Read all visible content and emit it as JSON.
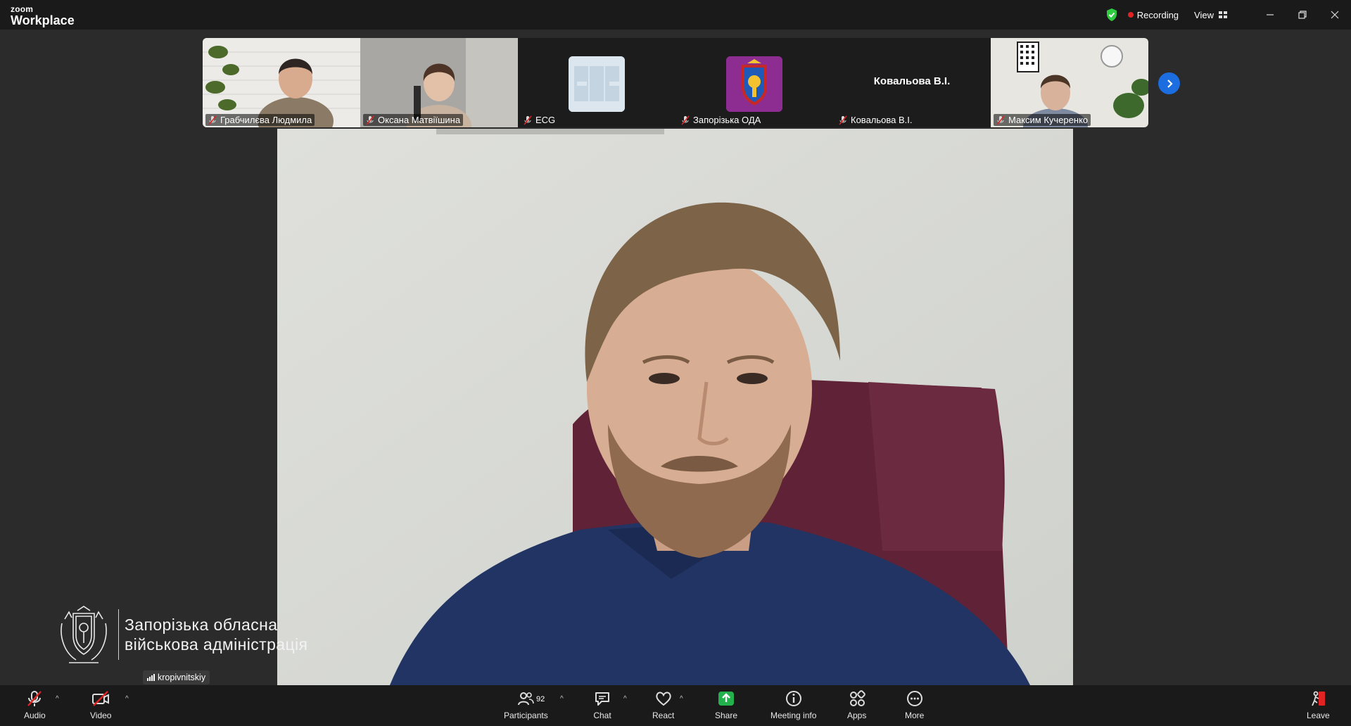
{
  "app": {
    "logo_small": "zoom",
    "logo_large": "Workplace"
  },
  "titlebar": {
    "recording_label": "Recording",
    "view_label": "View",
    "icons": [
      "shield-check-icon",
      "grid-icon",
      "minimize-icon",
      "restore-icon",
      "close-icon"
    ],
    "shield_color": "#2ecc40",
    "recording_color": "#e02424"
  },
  "thumbnails": [
    {
      "name": "Грабчилєва Людмила",
      "type": "video",
      "muted": true
    },
    {
      "name": "Оксана Матвіїшина",
      "type": "video",
      "muted": true
    },
    {
      "name": "ECG",
      "type": "avatar",
      "muted": true
    },
    {
      "name": "Запорізька ОДА",
      "type": "avatar",
      "muted": true
    },
    {
      "name": "Ковальова В.І.",
      "type": "name-only",
      "center_label": "Ковальова В.І.",
      "muted": true
    },
    {
      "name": "Максим Кучеренко",
      "type": "video",
      "muted": true
    }
  ],
  "main_video": {
    "icons": [
      "speaker-video"
    ]
  },
  "watermark": {
    "line1": "Запорізька обласна",
    "line2": "військова адміністрація"
  },
  "network_badge": {
    "label": "kropivnitskiy"
  },
  "toolbar": {
    "audio": "Audio",
    "video": "Video",
    "participants": "Participants",
    "participants_count": "92",
    "chat": "Chat",
    "react": "React",
    "share": "Share",
    "meeting_info": "Meeting info",
    "apps": "Apps",
    "more": "More",
    "leave": "Leave",
    "share_color": "#22b14c",
    "leave_color": "#e02424"
  }
}
